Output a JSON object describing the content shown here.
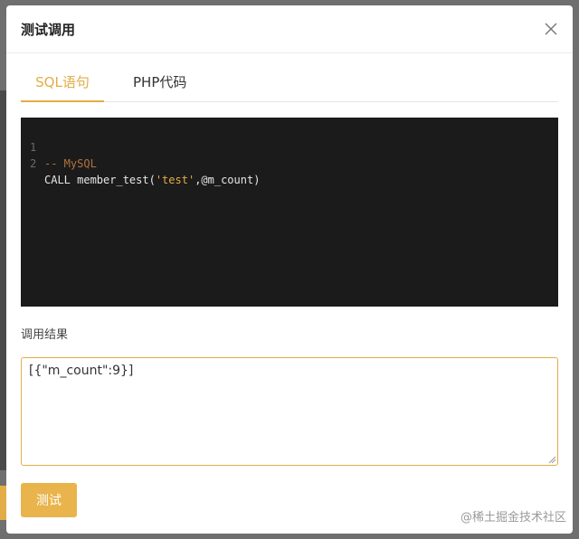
{
  "dialog": {
    "title": "测试调用",
    "close_icon": "close-icon"
  },
  "tabs": [
    {
      "label": "SQL语句",
      "active": true
    },
    {
      "label": "PHP代码",
      "active": false
    }
  ],
  "code": {
    "lines": [
      {
        "number": "1",
        "comment": "-- MySQL"
      },
      {
        "number": "2",
        "prefix": "CALL member_test(",
        "string": "'test'",
        "suffix": ",@m_count)"
      }
    ]
  },
  "result": {
    "label": "调用结果",
    "value": "[{\"m_count\":9}]"
  },
  "actions": {
    "test_label": "测试"
  },
  "watermark": "@稀土掘金技术社区",
  "colors": {
    "accent": "#e2ad46",
    "editor_bg": "#1b1b1b"
  }
}
